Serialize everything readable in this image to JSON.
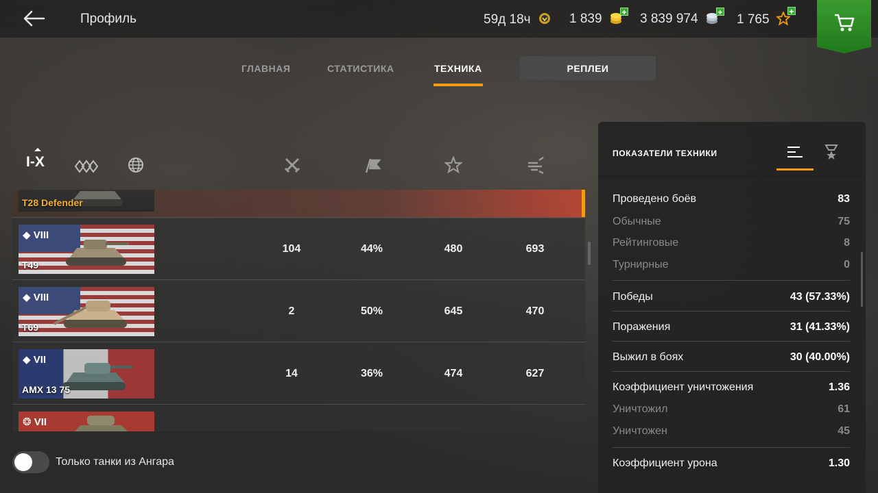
{
  "header": {
    "page_title": "Профиль",
    "premium_time": "59д 18ч",
    "gold": "1 839",
    "credits": "3 839 974",
    "free_xp": "1 765"
  },
  "tabs": [
    {
      "label": "ГЛАВНАЯ"
    },
    {
      "label": "СТАТИСТИКА"
    },
    {
      "label": "ТЕХНИКА"
    },
    {
      "label": "РЕПЛЕИ"
    }
  ],
  "filters": {
    "tier_filter": "I-X"
  },
  "vehicles": [
    {
      "name": "T28 Defender",
      "tier": "",
      "battles": "",
      "winrate": "",
      "avg_xp": "",
      "avg_dmg": "",
      "premium": true,
      "selected": true
    },
    {
      "name": "T49",
      "tier": "VIII",
      "battles": "104",
      "winrate": "44%",
      "avg_xp": "480",
      "avg_dmg": "693",
      "premium": false,
      "selected": false
    },
    {
      "name": "T69",
      "tier": "VIII",
      "battles": "2",
      "winrate": "50%",
      "avg_xp": "645",
      "avg_dmg": "470",
      "premium": false,
      "selected": false
    },
    {
      "name": "AMX 13 75",
      "tier": "VII",
      "battles": "14",
      "winrate": "36%",
      "avg_xp": "474",
      "avg_dmg": "627",
      "premium": false,
      "selected": false
    },
    {
      "name": "",
      "tier": "VII",
      "battles": "",
      "winrate": "",
      "avg_xp": "",
      "avg_dmg": "",
      "premium": false,
      "selected": false
    }
  ],
  "hangar_toggle": {
    "label": "Только танки из Ангара",
    "on": false
  },
  "panel": {
    "title": "ПОКАЗАТЕЛИ ТЕХНИКИ",
    "stats": [
      {
        "k": "Проведено боёв",
        "v": "83",
        "type": "main"
      },
      {
        "k": "Обычные",
        "v": "75",
        "type": "sub"
      },
      {
        "k": "Рейтинговые",
        "v": "8",
        "type": "sub"
      },
      {
        "k": "Турнирные",
        "v": "0",
        "type": "sub"
      },
      {
        "k": "Победы",
        "v": "43 (57.33%)",
        "type": "main"
      },
      {
        "k": "Поражения",
        "v": "31 (41.33%)",
        "type": "main"
      },
      {
        "k": "Выжил в боях",
        "v": "30 (40.00%)",
        "type": "main"
      },
      {
        "k": "Коэффициент уничтожения",
        "v": "1.36",
        "type": "main"
      },
      {
        "k": "Уничтожил",
        "v": "61",
        "type": "sub"
      },
      {
        "k": "Уничтожен",
        "v": "45",
        "type": "sub"
      },
      {
        "k": "Коэффициент урона",
        "v": "1.30",
        "type": "main"
      }
    ]
  },
  "colors": {
    "accent": "#f39c12",
    "premium_name": "#f5b031",
    "shop": "#2e8b28"
  }
}
